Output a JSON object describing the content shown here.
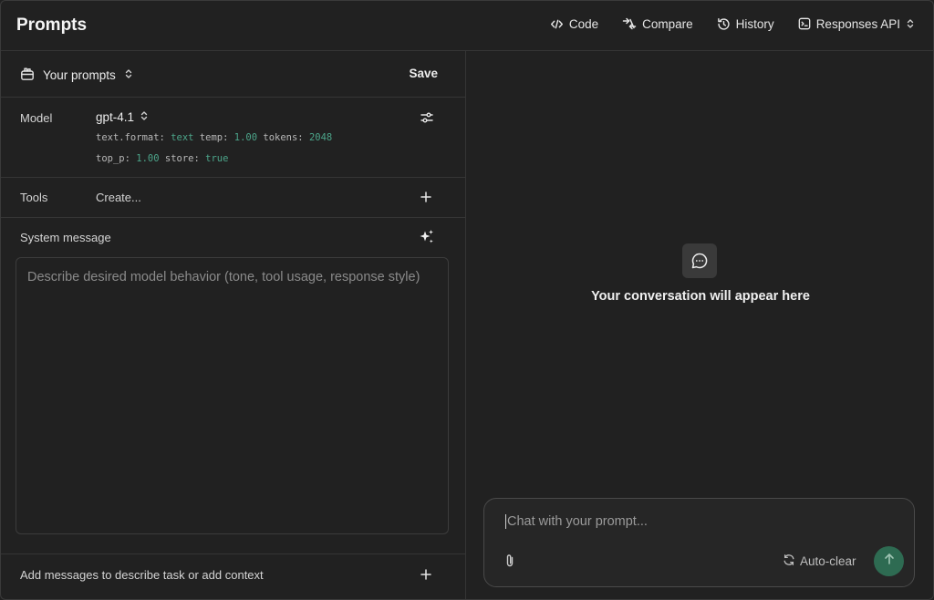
{
  "header": {
    "title": "Prompts",
    "actions": [
      {
        "label": "Code",
        "icon": "code-icon"
      },
      {
        "label": "Compare",
        "icon": "compare-icon"
      },
      {
        "label": "History",
        "icon": "history-icon"
      },
      {
        "label": "Responses API",
        "icon": "terminal-icon"
      }
    ]
  },
  "prompts": {
    "selector_label": "Your prompts",
    "save_label": "Save"
  },
  "model": {
    "label": "Model",
    "name": "gpt-4.1",
    "params": {
      "format_key": "text.format:",
      "format_val": "text",
      "temp_key": "temp:",
      "temp_val": "1.00",
      "tokens_key": "tokens:",
      "tokens_val": "2048",
      "top_p_key": "top_p:",
      "top_p_val": "1.00",
      "store_key": "store:",
      "store_val": "true"
    }
  },
  "tools": {
    "label": "Tools",
    "create_label": "Create..."
  },
  "system": {
    "label": "System message",
    "placeholder": "Describe desired model behavior (tone, tool usage, response style)"
  },
  "messages": {
    "add_label": "Add messages to describe task or add context"
  },
  "conversation": {
    "empty_text": "Your conversation will appear here"
  },
  "chat": {
    "placeholder": "Chat with your prompt...",
    "autoclear_label": "Auto-clear"
  },
  "colors": {
    "background": "#212121",
    "accent_green": "#4ca58a",
    "send_button": "#2e6b52"
  }
}
